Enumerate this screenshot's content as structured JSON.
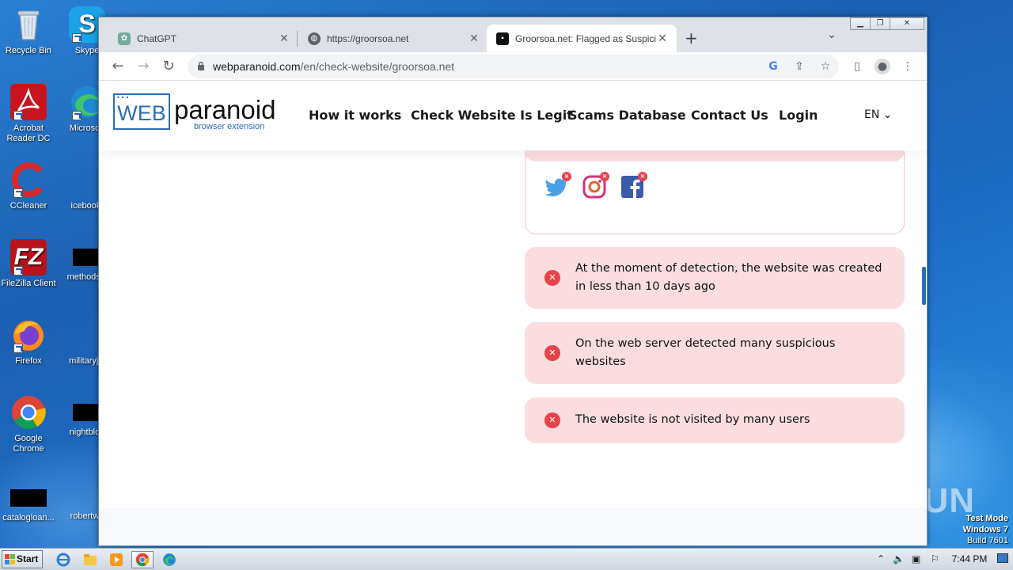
{
  "desktop": {
    "icons": [
      {
        "label": "Recycle Bin"
      },
      {
        "label": "Skype"
      },
      {
        "label": "Acrobat Reader DC"
      },
      {
        "label": "Microsoft"
      },
      {
        "label": "CCleaner"
      },
      {
        "label": "icebook."
      },
      {
        "label": "FileZilla Client"
      },
      {
        "label": "methodsla"
      },
      {
        "label": "Firefox"
      },
      {
        "label": "militaryjul"
      },
      {
        "label": "Google Chrome"
      },
      {
        "label": "nightblog"
      },
      {
        "label": "catalogloan..."
      },
      {
        "label": "robertwo"
      }
    ],
    "watermark": "ANY RUN",
    "test_mode": {
      "line1": "Test Mode",
      "line2": "Windows 7",
      "line3": "Build 7601"
    }
  },
  "browser": {
    "tabs": [
      {
        "title": "ChatGPT",
        "active": false
      },
      {
        "title": "https://groorsoa.net",
        "active": false
      },
      {
        "title": "Groorsoa.net: Flagged as Suspicious",
        "active": true
      }
    ],
    "new_tab": "+",
    "address": {
      "host": "webparanoid.com",
      "path": "/en/check-website/groorsoa.net"
    }
  },
  "site": {
    "logo": {
      "box": "WEB",
      "word": "paranoid",
      "sub": "browser extension"
    },
    "nav": [
      "How it works",
      "Check Website Is Legit",
      "Scams Database",
      "Contact Us",
      "Login"
    ],
    "lang": "EN",
    "social": [
      "twitter-icon",
      "instagram-icon",
      "facebook-icon"
    ],
    "alerts": [
      "At the moment of detection, the website was created in less than 10 days ago",
      "On the web server detected many suspicious websites",
      "The website is not visited by many users"
    ],
    "colors": {
      "brand": "#2e6db4",
      "alert_bg": "#fbdde0",
      "alert_icon": "#e8434b"
    }
  },
  "taskbar": {
    "start": "Start",
    "clock": "7:44 PM"
  }
}
